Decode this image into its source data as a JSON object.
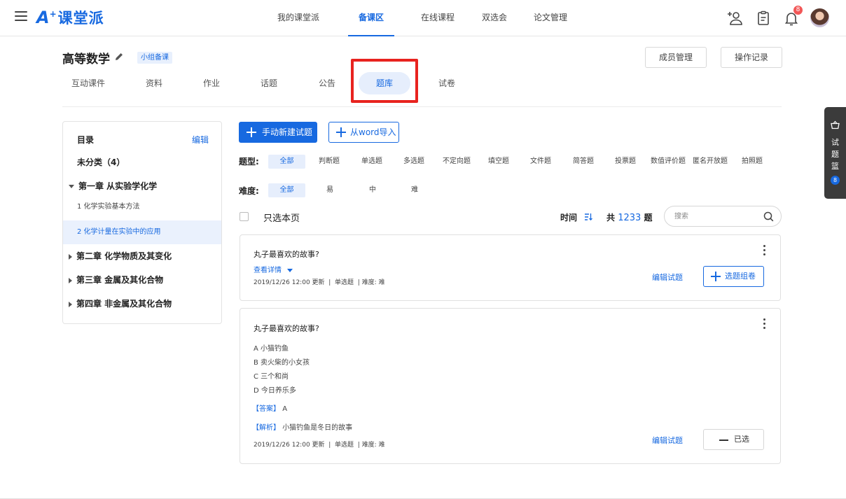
{
  "app": {
    "logo_mark": "A",
    "logo_sup": "+",
    "logo_name": "课堂派"
  },
  "topnav": [
    {
      "label": "我的课堂派"
    },
    {
      "label": "备课区"
    },
    {
      "label": "在线课程"
    },
    {
      "label": "双选会"
    },
    {
      "label": "论文管理"
    }
  ],
  "notifications": {
    "count": "8"
  },
  "course": {
    "title": "高等数学",
    "tag": "小组备课",
    "members_label": "成员管理",
    "log_label": "操作记录"
  },
  "subtabs": [
    {
      "label": "互动课件"
    },
    {
      "label": "资料"
    },
    {
      "label": "作业"
    },
    {
      "label": "话题"
    },
    {
      "label": "公告"
    },
    {
      "label": "题库"
    },
    {
      "label": "试卷"
    }
  ],
  "sidebar": {
    "title": "目录",
    "edit_label": "编辑",
    "items": [
      {
        "label": "未分类（4）"
      },
      {
        "label": "第一章 从实验学化学"
      },
      {
        "label": "1 化学实验基本方法"
      },
      {
        "label": "2 化学计量在实验中的应用"
      },
      {
        "label": "第二章 化学物质及其变化"
      },
      {
        "label": "第三章 金属及其化合物"
      },
      {
        "label": "第四章 非金属及其化合物"
      }
    ]
  },
  "toolbar": {
    "new_label": "手动新建试题",
    "import_label": "从word导入"
  },
  "filters": {
    "type_label": "题型:",
    "types": [
      "全部",
      "判断题",
      "单选题",
      "多选题",
      "不定向题",
      "填空题",
      "文件题",
      "简答题",
      "投票题",
      "数值评价题",
      "匿名开放题",
      "拍照题"
    ],
    "difficulty_label": "难度:",
    "difficulties": [
      "全部",
      "易",
      "中",
      "难"
    ]
  },
  "list": {
    "select_page_label": "只选本页",
    "sort_label": "时间",
    "total_prefix": "共",
    "total_count": "1233",
    "total_suffix": "题",
    "search_placeholder": "搜索"
  },
  "questions": [
    {
      "title": "丸子最喜欢的故事?",
      "details_label": "查看详情",
      "meta": "2019/12/26 12:00 更新  |  单选题  | 难度: 难",
      "edit_label": "编辑试题",
      "select_label": "选题组卷"
    },
    {
      "title": "丸子最喜欢的故事?",
      "options": [
        "A 小猫钓鱼",
        "B 卖火柴的小女孩",
        "C 三个和尚",
        "D 今日养乐多"
      ],
      "answer_label": "【答案】",
      "answer": "A",
      "analysis_label": "【解析】",
      "analysis": "小猫钓鱼是冬日的故事",
      "meta": "2019/12/26 12:00 更新  |  单选题  | 难度: 难",
      "edit_label": "编辑试题",
      "selected_label": "已选"
    }
  ],
  "basket": {
    "chars": [
      "试",
      "题",
      "篮"
    ],
    "count": "8"
  },
  "colors": {
    "accent": "#1769e0",
    "highlight": "#e8231f",
    "badge": "#f25757"
  }
}
